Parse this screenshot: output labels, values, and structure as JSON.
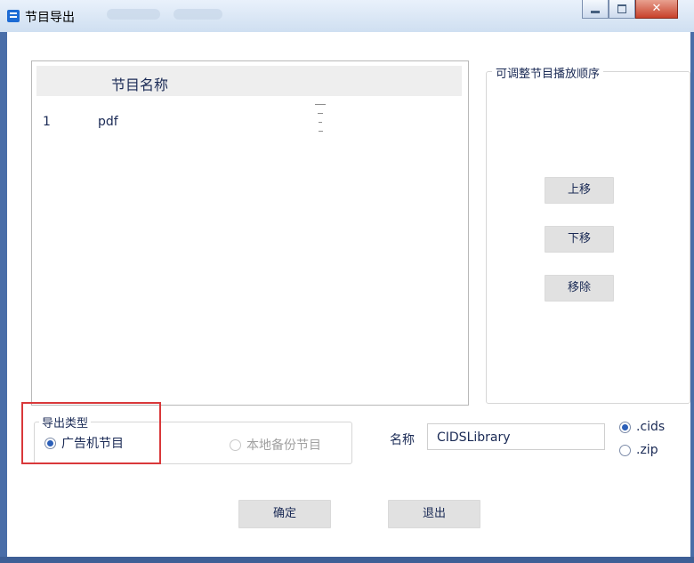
{
  "window": {
    "title": "节目导出"
  },
  "list": {
    "header_name": "节目名称",
    "rows": [
      {
        "index": "1",
        "name": "pdf"
      }
    ]
  },
  "order_group": {
    "legend": "可调整节目播放顺序",
    "move_up": "上移",
    "move_down": "下移",
    "remove": "移除"
  },
  "export_type": {
    "legend": "导出类型",
    "option_ad": "广告机节目",
    "option_backup": "本地备份节目",
    "selected": "广告机节目"
  },
  "name_field": {
    "label": "名称",
    "value": "CIDSLibrary"
  },
  "format": {
    "option_cids": ".cids",
    "option_zip": ".zip",
    "selected": ".cids"
  },
  "actions": {
    "confirm": "确定",
    "exit": "退出"
  },
  "colors": {
    "highlight": "#d9383a",
    "title_bar": "#cfdff1",
    "accent": "#2b5fb8"
  }
}
